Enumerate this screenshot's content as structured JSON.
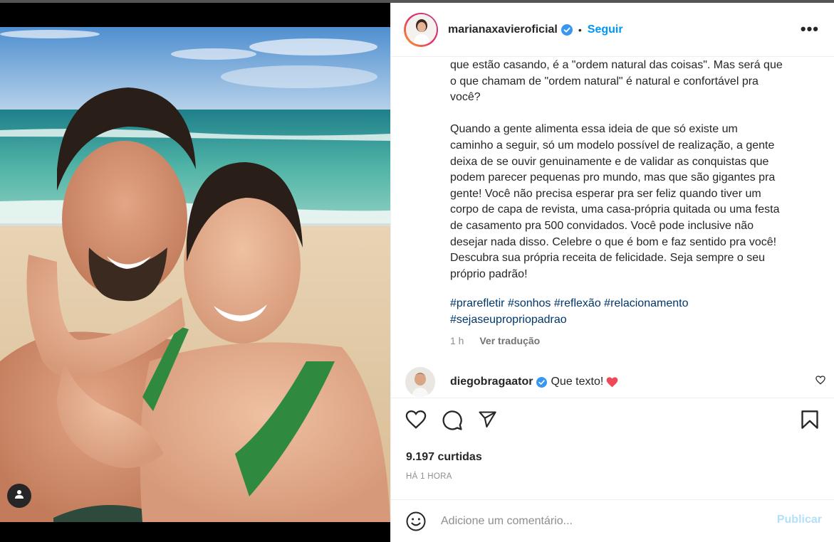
{
  "post": {
    "author": "marianaxavieroficial",
    "follow_label": "Seguir",
    "dot": "•",
    "more_label": "•••",
    "caption_text": "que estão casando, é a \"ordem natural das coisas\". Mas será que\no que chamam de \"ordem natural\" é natural e confortável pra\nvocê?\n\nQuando a gente alimenta essa ideia de que só existe um\ncaminho a seguir, só um modelo possível de realização, a gente\ndeixa de se ouvir genuinamente e de validar as conquistas que\npodem parecer pequenas pro mundo, mas que são gigantes pra\ngente! Você não precisa esperar pra ser feliz quando tiver um\ncorpo de capa de revista, uma casa-própria quitada ou uma festa\nde casamento pra 500 convidados. Você pode inclusive não\ndesejar nada disso. Celebre o que é bom e faz sentido pra você!\nDescubra sua própria receita de felicidade. Seja sempre o seu\npróprio padrão!",
    "hashtags": [
      "#prarefletir",
      "#sonhos",
      "#reflexão",
      "#relacionamento",
      "#sejaseupropriopadrao"
    ],
    "caption_age": "1 h",
    "translate_label": "Ver tradução",
    "likes": "9.197 curtidas",
    "posted_ago": "HÁ 1 HORA"
  },
  "comment": {
    "user": "diegobragaator",
    "text": "Que texto!",
    "emoji": "❤️"
  },
  "comment_bar": {
    "placeholder": "Adicione um comentário...",
    "publish_label": "Publicar"
  },
  "icons": {
    "verified": "verified-badge-icon",
    "like": "heart-icon",
    "comment": "comment-icon",
    "share": "paper-plane-icon",
    "save": "bookmark-icon",
    "emoji": "smiley-icon",
    "tag": "user-tag-icon"
  },
  "colors": {
    "accent": "#0095f6",
    "hashtag": "#00376b",
    "publish_disabled": "#b2dffc",
    "heart_red": "#ed4956"
  }
}
